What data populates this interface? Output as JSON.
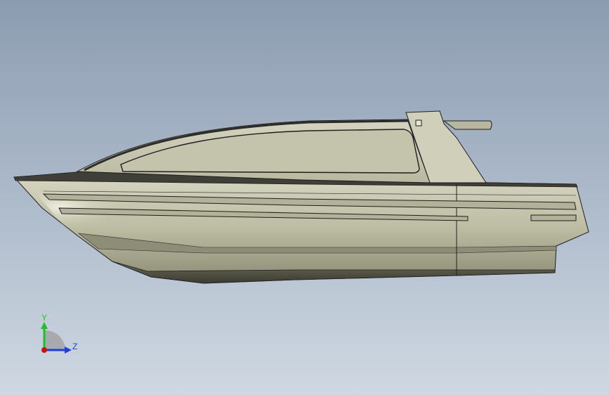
{
  "viewport": {
    "background_top": "#8c9cb0",
    "background_bottom": "#cfd8e2"
  },
  "model": {
    "hull_color": "#c9c9b0",
    "hull_shadow": "#5a5a4a",
    "outline_color": "#1e1e1e"
  },
  "triad": {
    "y_label": "Y",
    "z_label": "Z",
    "y_color": "#1fbf2a",
    "z_color": "#1f3fd6",
    "x_color": "#d01010"
  }
}
